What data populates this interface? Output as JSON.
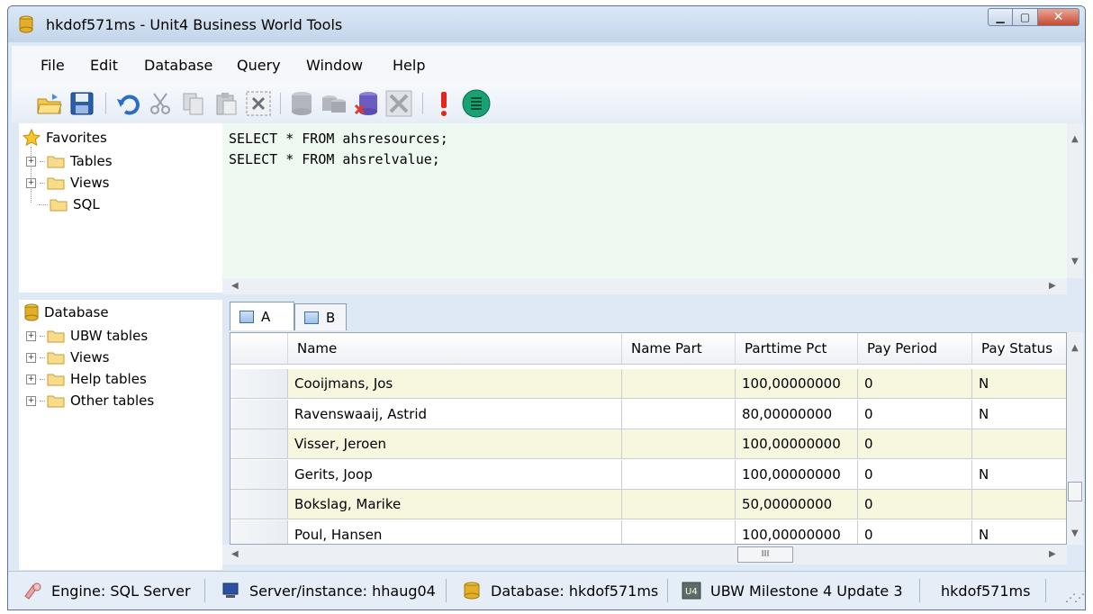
{
  "window": {
    "title": "hkdof571ms  -  Unit4 Business World Tools"
  },
  "menu": [
    "File",
    "Edit",
    "Database",
    "Query",
    "Window",
    "Help"
  ],
  "toolbar_icons": [
    "open-folder-icon",
    "save-disk-icon",
    "undo-icon",
    "cut-scissors-icon",
    "copy-icon",
    "paste-icon",
    "delete-icon",
    "database-icon",
    "database-stack-icon",
    "database-delete-icon",
    "tools-icon",
    "exclamation-icon",
    "execute-icon"
  ],
  "favorites": {
    "root": "Favorites",
    "items": [
      "Tables",
      "Views",
      "SQL"
    ]
  },
  "database_tree": {
    "root": "Database",
    "items": [
      "UBW tables",
      "Views",
      "Help tables",
      "Other tables"
    ]
  },
  "editor": {
    "lines": [
      "SELECT * FROM ahsresources;",
      "SELECT * FROM ahsrelvalue;"
    ],
    "background": "#eef9f1"
  },
  "result_tabs": [
    "A",
    "B"
  ],
  "grid": {
    "columns": [
      "Name",
      "Name Part",
      "Parttime Pct",
      "Pay Period",
      "Pay Status"
    ],
    "rows": [
      [
        "Cooijmans, Jos",
        "",
        "100,00000000",
        "0",
        "N"
      ],
      [
        "Ravenswaaij, Astrid",
        "",
        "80,00000000",
        "0",
        "N"
      ],
      [
        "Visser, Jeroen",
        "",
        "100,00000000",
        "0",
        ""
      ],
      [
        "Gerits, Joop",
        "",
        "100,00000000",
        "0",
        "N"
      ],
      [
        "Bokslag, Marike",
        "",
        "50,00000000",
        "0",
        ""
      ],
      [
        "Poul, Hansen",
        "",
        "100,00000000",
        "0",
        "N"
      ]
    ],
    "alt_row_color": "#f7f6de"
  },
  "hscroll_thumb_label": "III",
  "status": {
    "engine": "Engine: SQL Server",
    "server": "Server/instance: hhaug04",
    "database": "Database: hkdof571ms",
    "version": "UBW Milestone 4 Update 3",
    "user": "hkdof571ms"
  }
}
